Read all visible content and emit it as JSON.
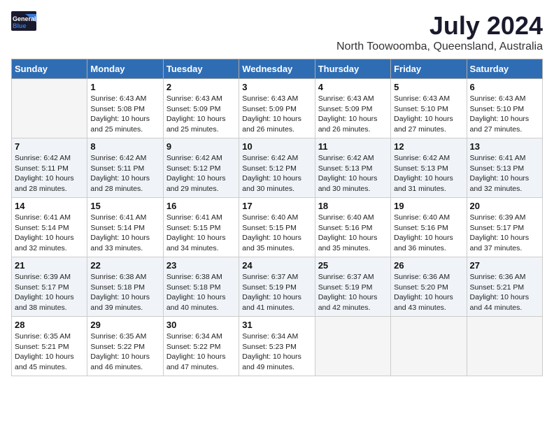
{
  "logo": {
    "general": "General",
    "blue": "Blue"
  },
  "title": {
    "month_year": "July 2024",
    "location": "North Toowoomba, Queensland, Australia"
  },
  "days_of_week": [
    "Sunday",
    "Monday",
    "Tuesday",
    "Wednesday",
    "Thursday",
    "Friday",
    "Saturday"
  ],
  "weeks": [
    [
      {
        "day": "",
        "info": ""
      },
      {
        "day": "1",
        "info": "Sunrise: 6:43 AM\nSunset: 5:08 PM\nDaylight: 10 hours\nand 25 minutes."
      },
      {
        "day": "2",
        "info": "Sunrise: 6:43 AM\nSunset: 5:09 PM\nDaylight: 10 hours\nand 25 minutes."
      },
      {
        "day": "3",
        "info": "Sunrise: 6:43 AM\nSunset: 5:09 PM\nDaylight: 10 hours\nand 26 minutes."
      },
      {
        "day": "4",
        "info": "Sunrise: 6:43 AM\nSunset: 5:09 PM\nDaylight: 10 hours\nand 26 minutes."
      },
      {
        "day": "5",
        "info": "Sunrise: 6:43 AM\nSunset: 5:10 PM\nDaylight: 10 hours\nand 27 minutes."
      },
      {
        "day": "6",
        "info": "Sunrise: 6:43 AM\nSunset: 5:10 PM\nDaylight: 10 hours\nand 27 minutes."
      }
    ],
    [
      {
        "day": "7",
        "info": "Sunrise: 6:42 AM\nSunset: 5:11 PM\nDaylight: 10 hours\nand 28 minutes."
      },
      {
        "day": "8",
        "info": "Sunrise: 6:42 AM\nSunset: 5:11 PM\nDaylight: 10 hours\nand 28 minutes."
      },
      {
        "day": "9",
        "info": "Sunrise: 6:42 AM\nSunset: 5:12 PM\nDaylight: 10 hours\nand 29 minutes."
      },
      {
        "day": "10",
        "info": "Sunrise: 6:42 AM\nSunset: 5:12 PM\nDaylight: 10 hours\nand 30 minutes."
      },
      {
        "day": "11",
        "info": "Sunrise: 6:42 AM\nSunset: 5:13 PM\nDaylight: 10 hours\nand 30 minutes."
      },
      {
        "day": "12",
        "info": "Sunrise: 6:42 AM\nSunset: 5:13 PM\nDaylight: 10 hours\nand 31 minutes."
      },
      {
        "day": "13",
        "info": "Sunrise: 6:41 AM\nSunset: 5:13 PM\nDaylight: 10 hours\nand 32 minutes."
      }
    ],
    [
      {
        "day": "14",
        "info": "Sunrise: 6:41 AM\nSunset: 5:14 PM\nDaylight: 10 hours\nand 32 minutes."
      },
      {
        "day": "15",
        "info": "Sunrise: 6:41 AM\nSunset: 5:14 PM\nDaylight: 10 hours\nand 33 minutes."
      },
      {
        "day": "16",
        "info": "Sunrise: 6:41 AM\nSunset: 5:15 PM\nDaylight: 10 hours\nand 34 minutes."
      },
      {
        "day": "17",
        "info": "Sunrise: 6:40 AM\nSunset: 5:15 PM\nDaylight: 10 hours\nand 35 minutes."
      },
      {
        "day": "18",
        "info": "Sunrise: 6:40 AM\nSunset: 5:16 PM\nDaylight: 10 hours\nand 35 minutes."
      },
      {
        "day": "19",
        "info": "Sunrise: 6:40 AM\nSunset: 5:16 PM\nDaylight: 10 hours\nand 36 minutes."
      },
      {
        "day": "20",
        "info": "Sunrise: 6:39 AM\nSunset: 5:17 PM\nDaylight: 10 hours\nand 37 minutes."
      }
    ],
    [
      {
        "day": "21",
        "info": "Sunrise: 6:39 AM\nSunset: 5:17 PM\nDaylight: 10 hours\nand 38 minutes."
      },
      {
        "day": "22",
        "info": "Sunrise: 6:38 AM\nSunset: 5:18 PM\nDaylight: 10 hours\nand 39 minutes."
      },
      {
        "day": "23",
        "info": "Sunrise: 6:38 AM\nSunset: 5:18 PM\nDaylight: 10 hours\nand 40 minutes."
      },
      {
        "day": "24",
        "info": "Sunrise: 6:37 AM\nSunset: 5:19 PM\nDaylight: 10 hours\nand 41 minutes."
      },
      {
        "day": "25",
        "info": "Sunrise: 6:37 AM\nSunset: 5:19 PM\nDaylight: 10 hours\nand 42 minutes."
      },
      {
        "day": "26",
        "info": "Sunrise: 6:36 AM\nSunset: 5:20 PM\nDaylight: 10 hours\nand 43 minutes."
      },
      {
        "day": "27",
        "info": "Sunrise: 6:36 AM\nSunset: 5:21 PM\nDaylight: 10 hours\nand 44 minutes."
      }
    ],
    [
      {
        "day": "28",
        "info": "Sunrise: 6:35 AM\nSunset: 5:21 PM\nDaylight: 10 hours\nand 45 minutes."
      },
      {
        "day": "29",
        "info": "Sunrise: 6:35 AM\nSunset: 5:22 PM\nDaylight: 10 hours\nand 46 minutes."
      },
      {
        "day": "30",
        "info": "Sunrise: 6:34 AM\nSunset: 5:22 PM\nDaylight: 10 hours\nand 47 minutes."
      },
      {
        "day": "31",
        "info": "Sunrise: 6:34 AM\nSunset: 5:23 PM\nDaylight: 10 hours\nand 49 minutes."
      },
      {
        "day": "",
        "info": ""
      },
      {
        "day": "",
        "info": ""
      },
      {
        "day": "",
        "info": ""
      }
    ]
  ]
}
